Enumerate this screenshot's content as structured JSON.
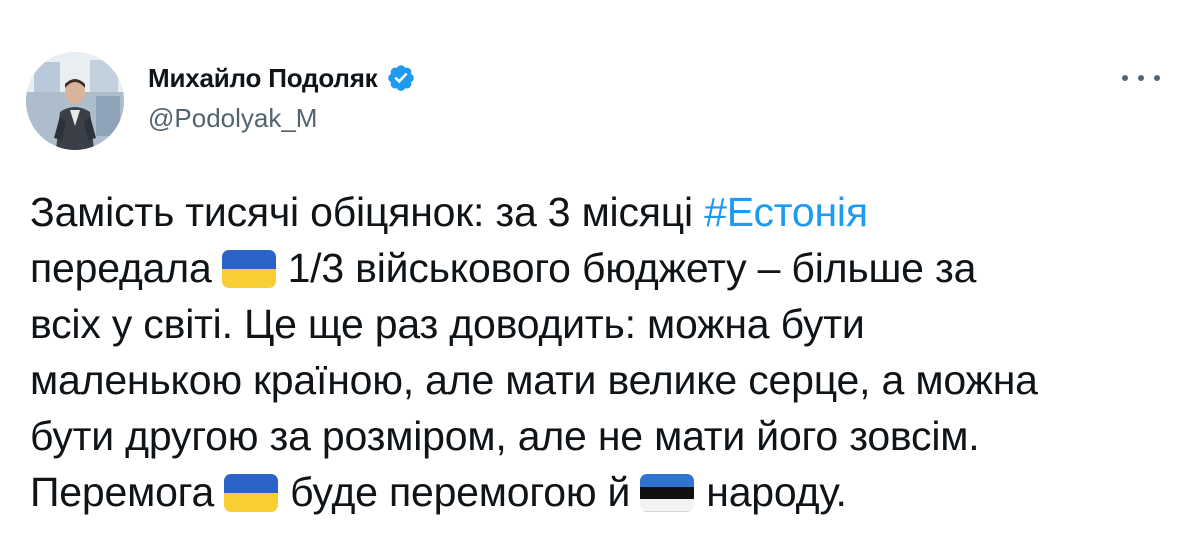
{
  "author": {
    "name": "Михайло Подоляк",
    "handle": "@Podolyak_M",
    "verified": true,
    "verified_color": "#1d9bf0"
  },
  "more_icon": "more-horizontal-icon",
  "tweet": {
    "line1_text": "Замість тисячі обіцянок: за 3 місяці",
    "hashtag": "#Естонія",
    "hashtag_color": "#1d9bf0",
    "line2_before": "передала",
    "line2_after": "1/3 військового бюджету – більше за",
    "line3": "всіх у світі. Це ще раз доводить: можна бути",
    "line4": "маленькою країною, але мати велике серце, а можна",
    "line5": "бути другою за розміром, але не мати його зовсім.",
    "line6_before": "Перемога",
    "line6_middle": "буде перемогою й",
    "line6_after": "народу.",
    "flags": {
      "ukraine": [
        "#2c63c8",
        "#f7cf34"
      ],
      "estonia": [
        "#2f74d0",
        "#111111",
        "#f3f3f3"
      ]
    }
  }
}
